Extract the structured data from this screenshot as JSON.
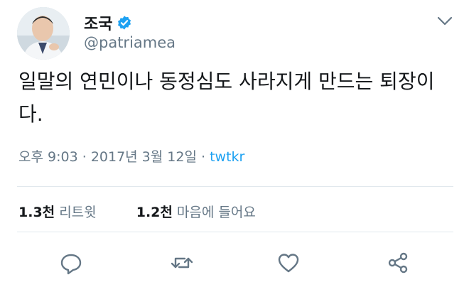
{
  "profile": {
    "display_name": "조국",
    "handle": "@patriamea",
    "verified": true
  },
  "tweet": {
    "text": "일말의 연민이나 동정심도 사라지게 만드는 퇴장이다.",
    "time": "오후 9:03",
    "date": "2017년 3월 12일",
    "separator": "·",
    "source": "twtkr"
  },
  "stats": {
    "retweets_count": "1.3천",
    "retweets_label": "리트윗",
    "likes_count": "1.2천",
    "likes_label": "마음에 들어요"
  },
  "colors": {
    "accent": "#1da1f2",
    "secondary_text": "#657786",
    "icon": "#657786"
  },
  "icons": {
    "verified": "verified-badge-icon",
    "more": "chevron-down-icon",
    "reply": "reply-icon",
    "retweet": "retweet-icon",
    "like": "heart-icon",
    "share": "share-icon"
  }
}
